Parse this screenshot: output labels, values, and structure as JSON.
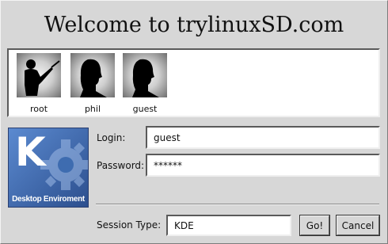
{
  "title": "Welcome to trylinuxSD.com",
  "users": [
    {
      "name": "root",
      "icon": "conductor-icon"
    },
    {
      "name": "phil",
      "icon": "head-silhouette-icon"
    },
    {
      "name": "guest",
      "icon": "head-silhouette-icon"
    }
  ],
  "logo": {
    "letter": "K",
    "caption": "Desktop Enviroment"
  },
  "login": {
    "label": "Login:",
    "value": "guest"
  },
  "password": {
    "label": "Password:",
    "value": "******"
  },
  "session": {
    "label": "Session Type:",
    "value": "KDE"
  },
  "buttons": {
    "go": "Go!",
    "cancel": "Cancel"
  },
  "colors": {
    "background": "#d7d7d7",
    "logo_blue": "#3e6cb0"
  }
}
